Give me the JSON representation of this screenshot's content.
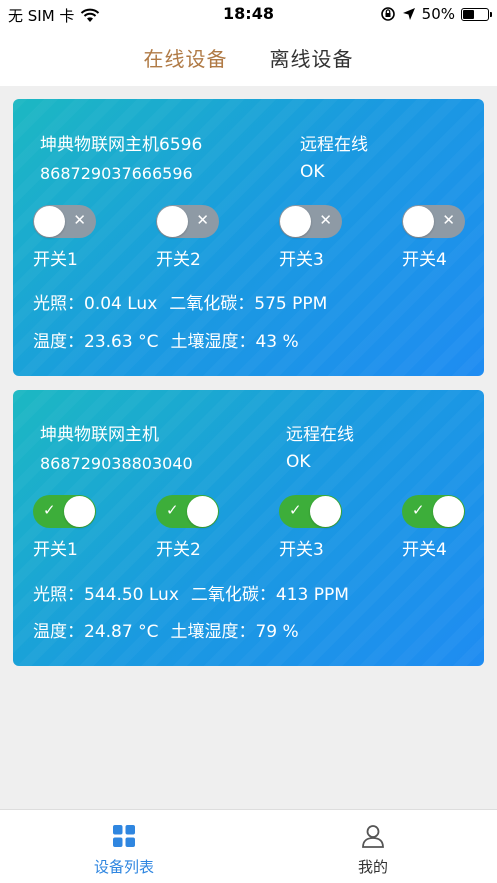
{
  "status_bar": {
    "carrier": "无 SIM 卡",
    "time": "18:48",
    "battery_text": "50%",
    "battery_level": 0.5,
    "icons": [
      "wifi-icon",
      "orientation-lock-icon",
      "location-arrow-icon",
      "battery-icon"
    ]
  },
  "top_tabs": [
    {
      "label": "在线设备",
      "active": true
    },
    {
      "label": "离线设备",
      "active": false
    }
  ],
  "devices": [
    {
      "name": "坤典物联网主机6596",
      "id": "868729037666596",
      "remote_label": "远程在线",
      "remote_status": "OK",
      "switches": [
        {
          "label": "开关1",
          "on": false
        },
        {
          "label": "开关2",
          "on": false
        },
        {
          "label": "开关3",
          "on": false
        },
        {
          "label": "开关4",
          "on": false
        }
      ],
      "light": "光照：0.04 Lux",
      "co2": "二氧化碳：575 PPM",
      "temperature": "温度：23.63 °C",
      "soil_humidity": "土壤湿度：43 %"
    },
    {
      "name": "坤典物联网主机",
      "id": "868729038803040",
      "remote_label": "远程在线",
      "remote_status": "OK",
      "switches": [
        {
          "label": "开关1",
          "on": true
        },
        {
          "label": "开关2",
          "on": true
        },
        {
          "label": "开关3",
          "on": true
        },
        {
          "label": "开关4",
          "on": true
        }
      ],
      "light": "光照：544.50 Lux",
      "co2": "二氧化碳：413 PPM",
      "temperature": "温度：24.87 °C",
      "soil_humidity": "土壤湿度：79 %"
    }
  ],
  "bottom_nav": [
    {
      "label": "设备列表",
      "icon": "grid-icon",
      "active": true
    },
    {
      "label": "我的",
      "icon": "user-icon",
      "active": false
    }
  ],
  "colors": {
    "accent": "#2f86e0",
    "tab_active": "#b07a45",
    "switch_on": "#3dae3a",
    "switch_off": "#8e9aa5"
  }
}
